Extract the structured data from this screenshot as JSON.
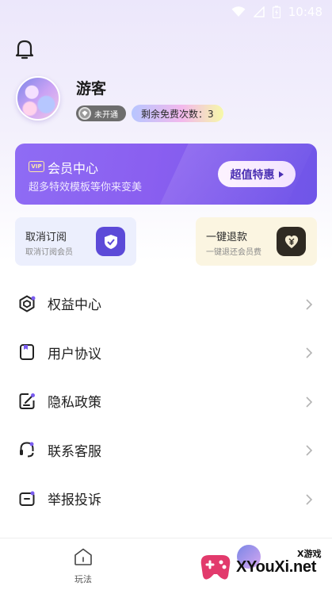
{
  "status_bar": {
    "time": "10:48",
    "icons": [
      "wifi-icon",
      "signal-icon",
      "battery-icon"
    ]
  },
  "header": {
    "bell_icon": "bell-icon"
  },
  "profile": {
    "username": "游客",
    "status_badge": "未开通",
    "free_badge": "剩余免费次数：3"
  },
  "vip_card": {
    "tag": "VIP",
    "title": "会员中心",
    "subtitle": "超多特效模板等你来变美",
    "button_label": "超值特惠",
    "colors": {
      "start": "#8f6cf4",
      "end": "#6f55e8"
    }
  },
  "actions": [
    {
      "title": "取消订阅",
      "subtitle": "取消订阅会员",
      "icon": "shield-icon"
    },
    {
      "title": "一键退款",
      "subtitle": "一键退还会员费",
      "icon": "yen-heart-icon"
    }
  ],
  "menu": [
    {
      "label": "权益中心",
      "icon": "hexagon-icon"
    },
    {
      "label": "用户协议",
      "icon": "document-icon"
    },
    {
      "label": "隐私政策",
      "icon": "edit-icon"
    },
    {
      "label": "联系客服",
      "icon": "headset-icon"
    },
    {
      "label": "举报投诉",
      "icon": "report-icon"
    }
  ],
  "bottom_nav": {
    "tabs": [
      {
        "label": "玩法",
        "icon": "home-icon"
      }
    ]
  },
  "watermark": {
    "small": "X游戏",
    "big": "XYouXi.net"
  }
}
